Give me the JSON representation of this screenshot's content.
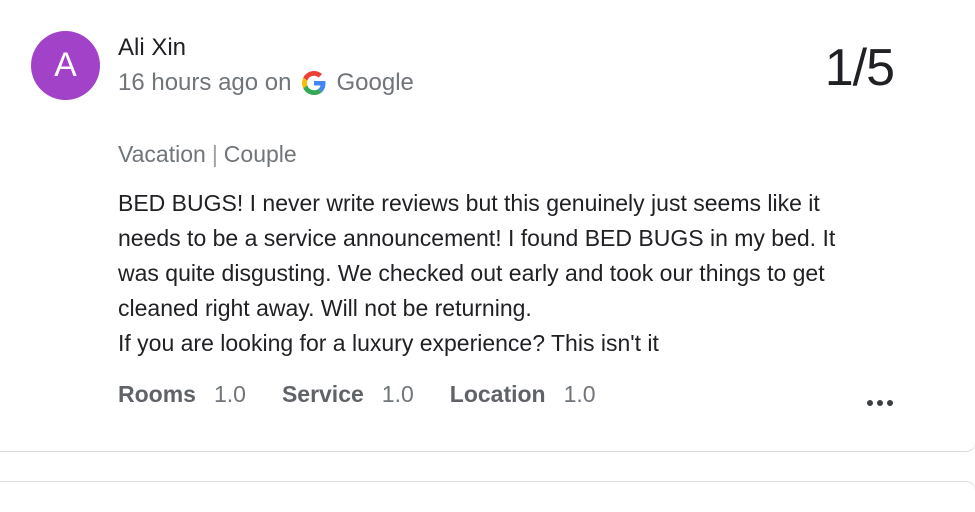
{
  "review": {
    "avatar_letter": "A",
    "author": "Ali Xin",
    "time": "16 hours ago on",
    "source": "Google",
    "score": "1/5",
    "trip_type": "Vacation",
    "trip_separator": "|",
    "traveler_type": "Couple",
    "text": "BED BUGS! I never write reviews but this genuinely just seems like it needs to be a service announcement! I found BED BUGS in my bed. It was quite disgusting. We checked out early and took our things to get cleaned right away. Will not be returning.\nIf you are looking for a luxury experience? This isn't it",
    "ratings": [
      {
        "label": "Rooms",
        "value": "1.0"
      },
      {
        "label": "Service",
        "value": "1.0"
      },
      {
        "label": "Location",
        "value": "1.0"
      }
    ],
    "avatar_color": "#a142c9",
    "more_icon": "more-horizontal-icon",
    "source_icon": "google-g-icon"
  }
}
